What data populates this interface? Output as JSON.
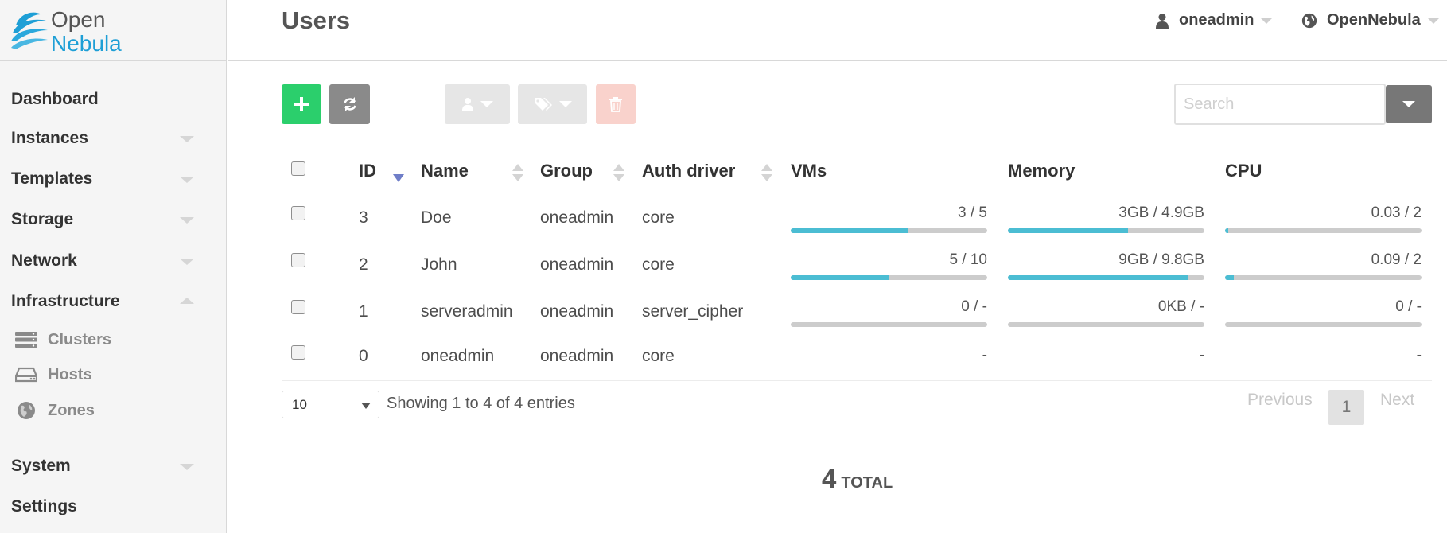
{
  "brand": {
    "line1": "Open",
    "line2": "Nebula",
    "accent": "#1e9fd6"
  },
  "sidebar": {
    "items": [
      {
        "label": "Dashboard",
        "has_caret": false
      },
      {
        "label": "Instances",
        "has_caret": true
      },
      {
        "label": "Templates",
        "has_caret": true
      },
      {
        "label": "Storage",
        "has_caret": true
      },
      {
        "label": "Network",
        "has_caret": true
      },
      {
        "label": "Infrastructure",
        "has_caret": true,
        "expanded": true
      },
      {
        "label": "System",
        "has_caret": true
      },
      {
        "label": "Settings",
        "has_caret": false
      }
    ],
    "subitems": [
      {
        "label": "Clusters",
        "icon": "server-icon"
      },
      {
        "label": "Hosts",
        "icon": "hdd-icon"
      },
      {
        "label": "Zones",
        "icon": "globe-icon"
      }
    ]
  },
  "header": {
    "title": "Users",
    "user_menu": "oneadmin",
    "zone_menu": "OpenNebula"
  },
  "toolbar": {
    "create_icon": "plus-icon",
    "refresh_icon": "refresh-icon",
    "user_icon": "user-icon",
    "label_icon": "tags-icon",
    "delete_icon": "trash-icon",
    "search_placeholder": "Search",
    "search_value": ""
  },
  "table": {
    "columns": [
      "ID",
      "Name",
      "Group",
      "Auth driver",
      "VMs",
      "Memory",
      "CPU"
    ],
    "sort": {
      "column": "ID",
      "direction": "desc"
    },
    "rows": [
      {
        "id": "3",
        "name": "Doe",
        "group": "oneadmin",
        "auth": "core",
        "vms": "3 / 5",
        "vms_pct": 60,
        "memory": "3GB / 4.9GB",
        "memory_pct": 61,
        "cpu": "0.03 / 2",
        "cpu_pct": 1.5
      },
      {
        "id": "2",
        "name": "John",
        "group": "oneadmin",
        "auth": "core",
        "vms": "5 / 10",
        "vms_pct": 50,
        "memory": "9GB / 9.8GB",
        "memory_pct": 92,
        "cpu": "0.09 / 2",
        "cpu_pct": 4.5
      },
      {
        "id": "1",
        "name": "serveradmin",
        "group": "oneadmin",
        "auth": "server_cipher",
        "vms": "0 / -",
        "vms_pct": 0,
        "memory": "0KB / -",
        "memory_pct": 0,
        "cpu": "0 / -",
        "cpu_pct": 0
      },
      {
        "id": "0",
        "name": "oneadmin",
        "group": "oneadmin",
        "auth": "core",
        "vms": "-",
        "memory": "-",
        "cpu": "-"
      }
    ]
  },
  "footer": {
    "page_length": "10",
    "info": "Showing 1 to 4 of 4 entries",
    "previous": "Previous",
    "current_page": "1",
    "next": "Next"
  },
  "summary": {
    "count": "4",
    "label": "TOTAL"
  },
  "colors": {
    "create": "#2bcf6c",
    "refresh": "#8a8a8a",
    "bar_fill": "#4bbdd3",
    "bar_track": "#cccccc",
    "delete": "#f9d2cc"
  }
}
